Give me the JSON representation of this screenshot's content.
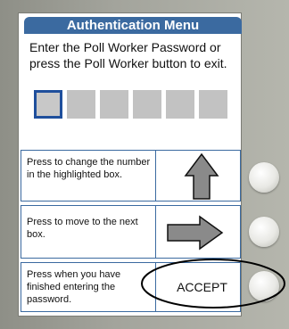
{
  "menu": {
    "title": "Authentication Menu",
    "instructions": "Enter the Poll Worker Password or press the Poll Worker button to exit."
  },
  "password": {
    "box_count": 6,
    "highlighted_index": 0
  },
  "rows": [
    {
      "text": "Press to change the number in the highlighted box.",
      "action": "up-arrow-icon"
    },
    {
      "text": "Press to move to the next box.",
      "action": "right-arrow-icon"
    },
    {
      "text": "Press when you have finished entering the password.",
      "action_label": "ACCEPT"
    }
  ],
  "colors": {
    "accent": "#3b6aa0",
    "highlight_border": "#1f4f9c",
    "callout": "#000000"
  }
}
